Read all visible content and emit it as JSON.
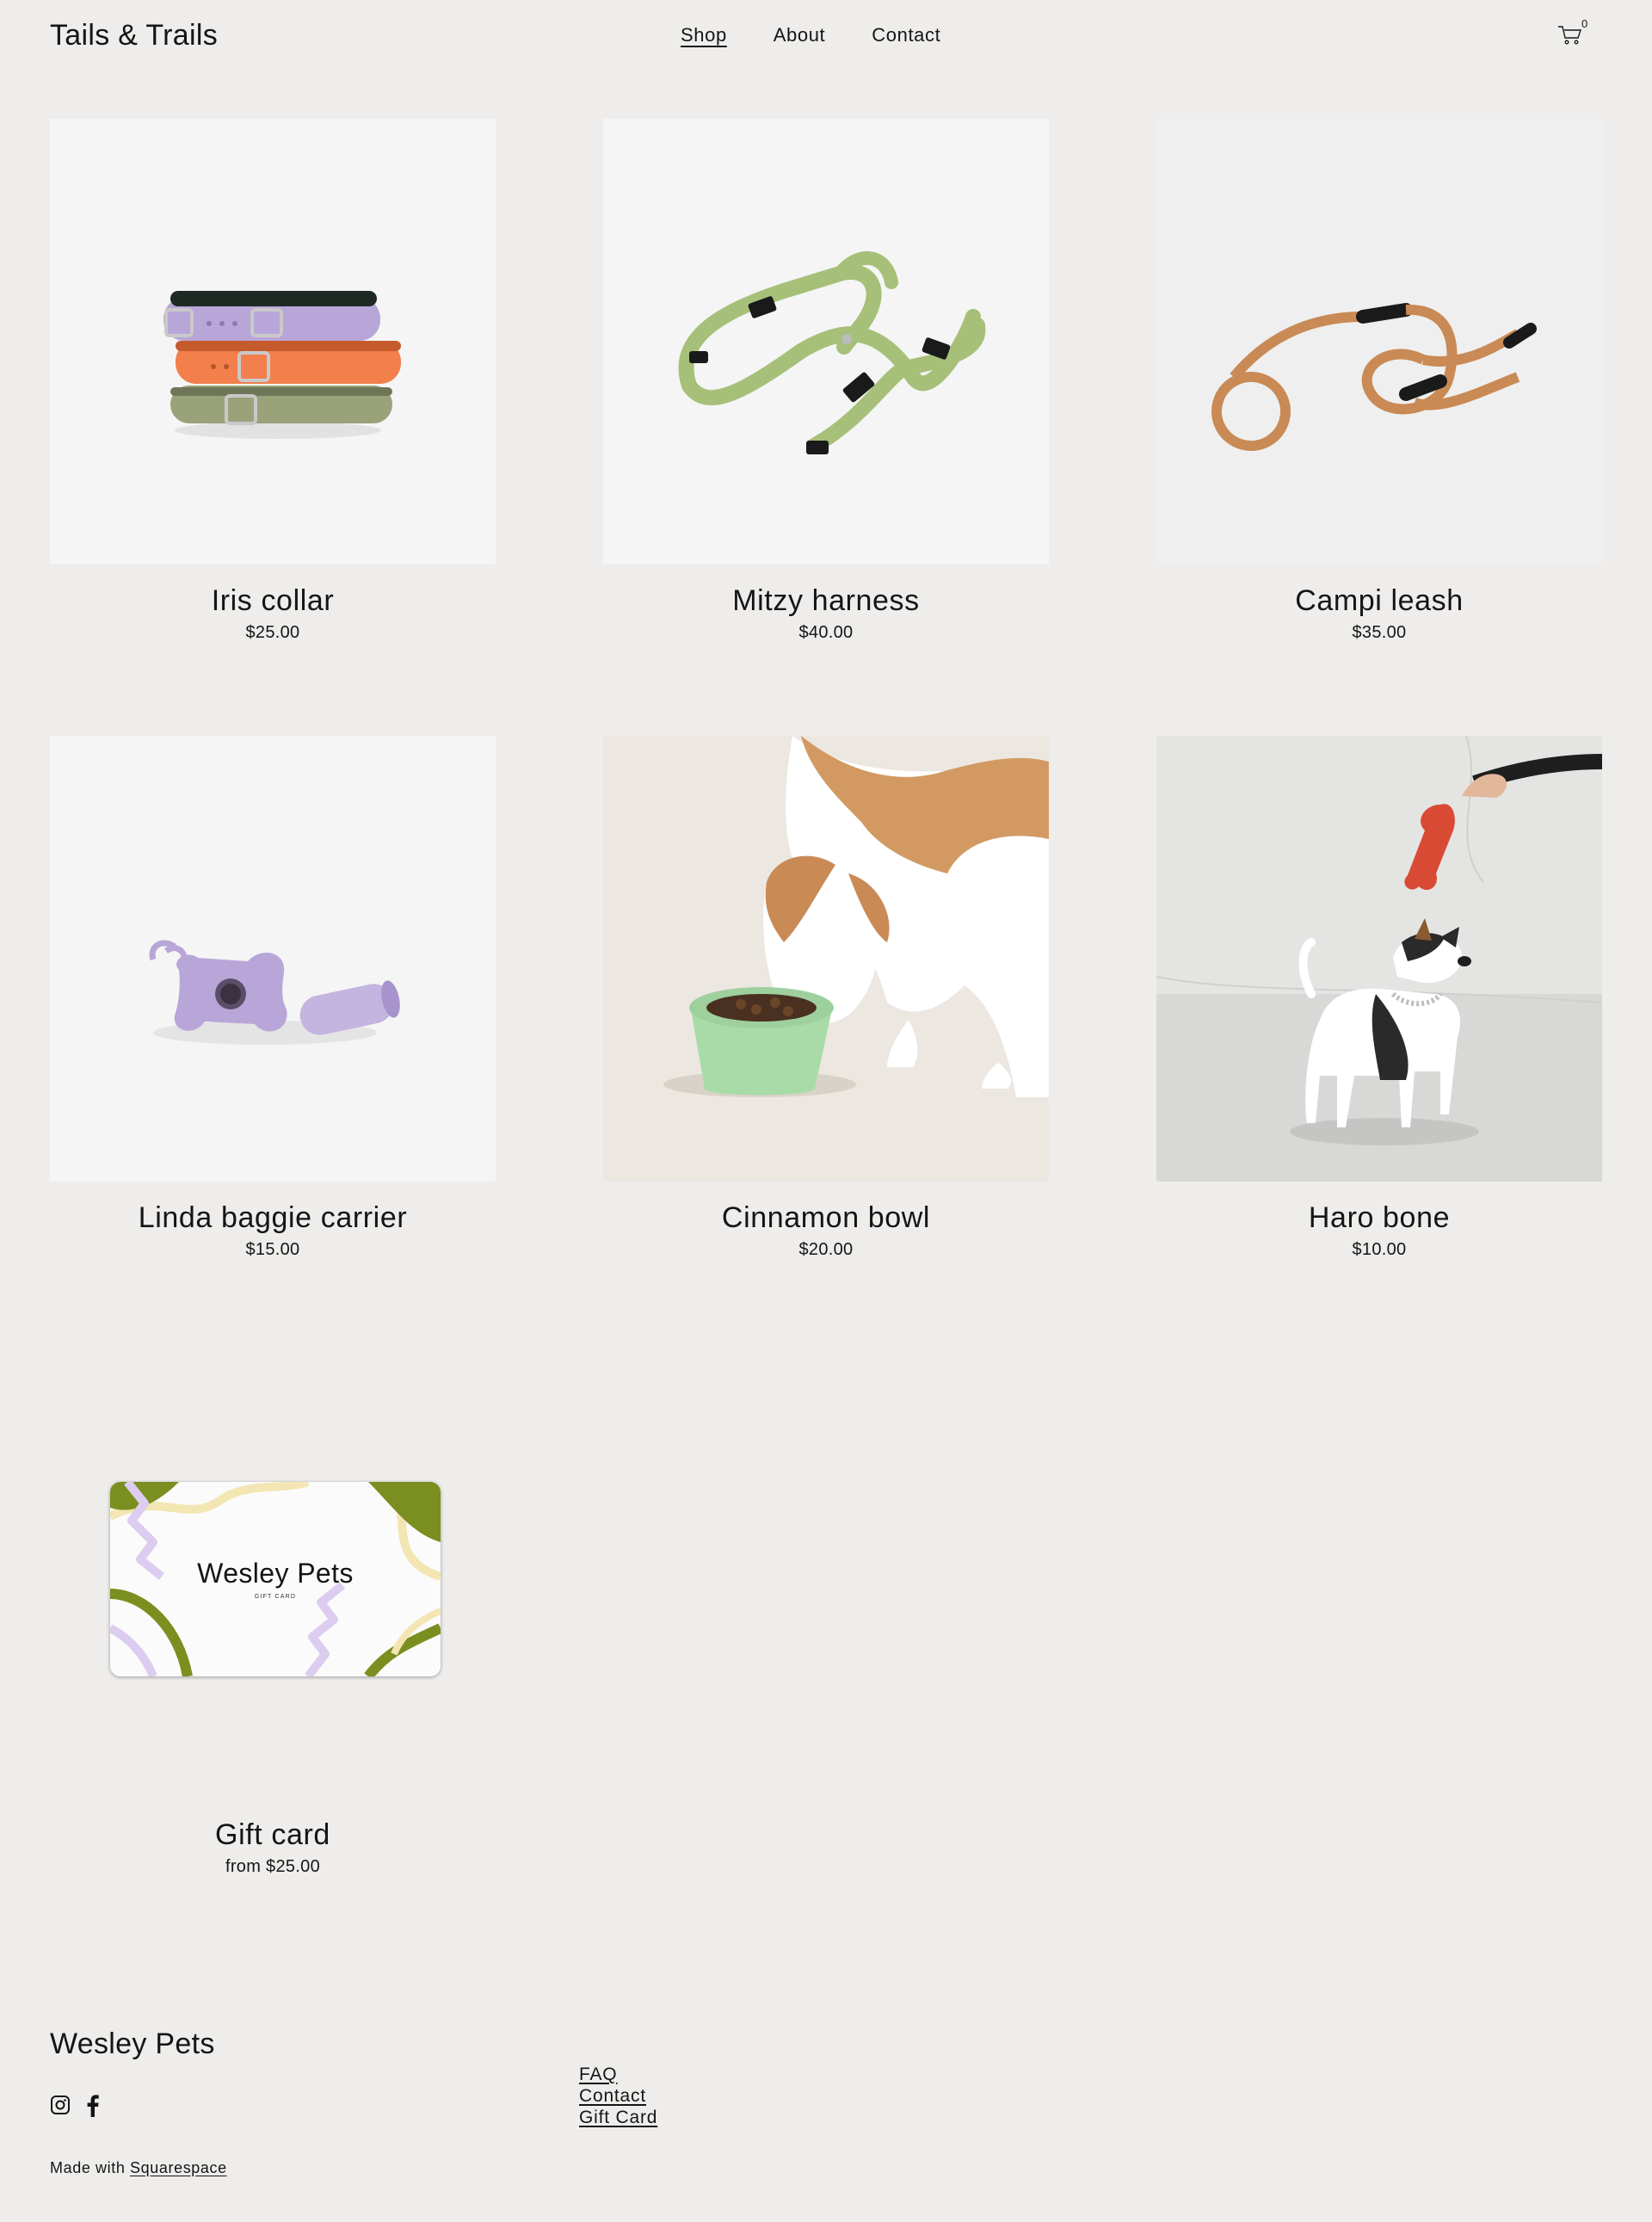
{
  "header": {
    "brand": "Tails & Trails",
    "nav": [
      {
        "label": "Shop",
        "active": true
      },
      {
        "label": "About",
        "active": false
      },
      {
        "label": "Contact",
        "active": false
      }
    ],
    "cart_count": "0",
    "cart_icon": "cart-icon"
  },
  "products": [
    {
      "name": "Iris collar",
      "price": "$25.00"
    },
    {
      "name": "Mitzy harness",
      "price": "$40.00"
    },
    {
      "name": "Campi leash",
      "price": "$35.00"
    },
    {
      "name": "Linda baggie carrier",
      "price": "$15.00"
    },
    {
      "name": "Cinnamon bowl",
      "price": "$20.00"
    },
    {
      "name": "Haro bone",
      "price": "$10.00"
    },
    {
      "name": "Gift card",
      "price": "from $25.00",
      "card_brand": "Wesley Pets",
      "card_subtitle": "GIFT CARD"
    }
  ],
  "footer": {
    "brand": "Wesley Pets",
    "social": [
      "instagram-icon",
      "facebook-icon"
    ],
    "made_with_prefix": "Made with",
    "made_with_link": "Squarespace",
    "links": [
      "FAQ",
      "Contact",
      "Gift Card"
    ]
  },
  "colors": {
    "background": "#eeedeb",
    "text": "#151515",
    "lavender": "#b9a6d8",
    "orange": "#f27f4c",
    "olive": "#9aa27a",
    "harness_green": "#a6c07a",
    "leash_tan": "#c98a55",
    "bowl_mint": "#a8dba8",
    "card_green": "#7a8f1f"
  }
}
